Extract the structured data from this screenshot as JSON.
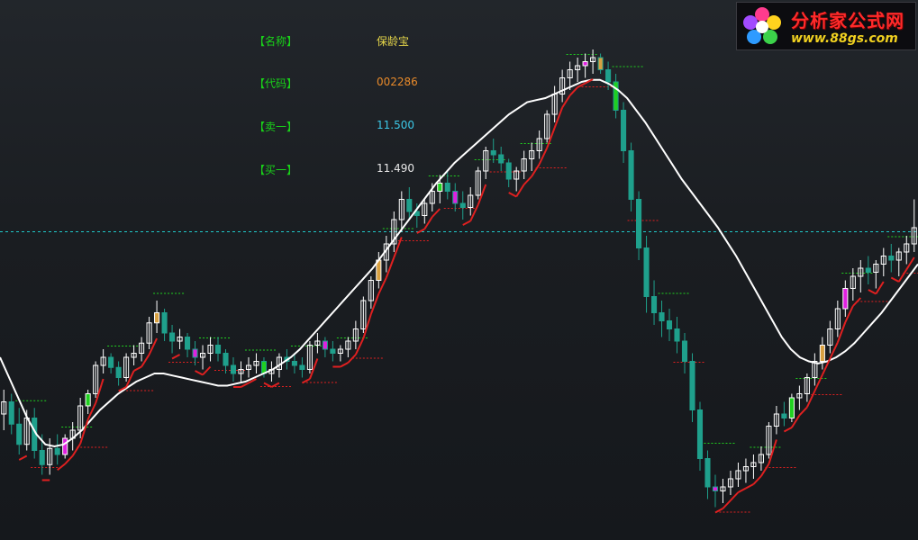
{
  "window": {
    "background": "#1c1f23"
  },
  "info_panel": [
    {
      "label": "【名称】",
      "value": "保龄宝",
      "color": "#e8d84a"
    },
    {
      "label": "【代码】",
      "value": "002286",
      "color": "#e88a2a"
    },
    {
      "label": "【卖一】",
      "value": "11.500",
      "color": "#3cc8e8"
    },
    {
      "label": "【买一】",
      "value": "11.490",
      "color": "#e8e8e8"
    }
  ],
  "logo": {
    "title": "分析家公式网",
    "url": "www.88gs.com"
  },
  "colors": {
    "up": "#ffffff",
    "down": "#1fa08c",
    "ma": "#ffffff",
    "red_line": "#e02020",
    "green_dash": "#1fd01f",
    "red_dash": "#e02020",
    "price_line": "#1fc8c8",
    "accent_magenta": "#e020e0",
    "accent_green": "#20d020",
    "accent_orange": "#d8a040"
  },
  "chart_data": {
    "type": "candlestick",
    "reference_price": 11.5,
    "candles": [
      [
        10.6,
        10.72,
        10.52,
        10.66
      ],
      [
        10.66,
        10.7,
        10.5,
        10.55
      ],
      [
        10.55,
        10.63,
        10.4,
        10.45
      ],
      [
        10.45,
        10.62,
        10.42,
        10.58
      ],
      [
        10.58,
        10.63,
        10.38,
        10.42
      ],
      [
        10.42,
        10.5,
        10.3,
        10.35
      ],
      [
        10.35,
        10.48,
        10.3,
        10.43
      ],
      [
        10.43,
        10.5,
        10.35,
        10.4
      ],
      [
        10.4,
        10.5,
        10.38,
        10.48
      ],
      [
        10.48,
        10.56,
        10.42,
        10.52
      ],
      [
        10.52,
        10.68,
        10.48,
        10.64
      ],
      [
        10.64,
        10.72,
        10.6,
        10.7
      ],
      [
        10.7,
        10.86,
        10.68,
        10.84
      ],
      [
        10.84,
        10.92,
        10.8,
        10.88
      ],
      [
        10.88,
        10.9,
        10.8,
        10.83
      ],
      [
        10.83,
        10.86,
        10.74,
        10.78
      ],
      [
        10.78,
        10.9,
        10.76,
        10.88
      ],
      [
        10.88,
        10.94,
        10.84,
        10.9
      ],
      [
        10.9,
        10.98,
        10.86,
        10.95
      ],
      [
        10.95,
        11.08,
        10.92,
        11.05
      ],
      [
        11.05,
        11.16,
        11.0,
        11.1
      ],
      [
        11.1,
        11.12,
        10.96,
        11.0
      ],
      [
        11.0,
        11.04,
        10.9,
        10.96
      ],
      [
        10.96,
        11.02,
        10.92,
        10.98
      ],
      [
        10.98,
        11.0,
        10.88,
        10.92
      ],
      [
        10.92,
        10.96,
        10.84,
        10.88
      ],
      [
        10.88,
        10.94,
        10.82,
        10.9
      ],
      [
        10.9,
        10.98,
        10.86,
        10.94
      ],
      [
        10.94,
        10.98,
        10.86,
        10.9
      ],
      [
        10.9,
        10.92,
        10.8,
        10.84
      ],
      [
        10.84,
        10.88,
        10.76,
        10.8
      ],
      [
        10.8,
        10.86,
        10.76,
        10.82
      ],
      [
        10.82,
        10.88,
        10.78,
        10.84
      ],
      [
        10.84,
        10.9,
        10.8,
        10.86
      ],
      [
        10.86,
        10.88,
        10.78,
        10.8
      ],
      [
        10.8,
        10.86,
        10.76,
        10.82
      ],
      [
        10.82,
        10.9,
        10.78,
        10.88
      ],
      [
        10.88,
        10.92,
        10.82,
        10.86
      ],
      [
        10.86,
        10.9,
        10.8,
        10.84
      ],
      [
        10.84,
        10.88,
        10.78,
        10.82
      ],
      [
        10.82,
        10.96,
        10.8,
        10.94
      ],
      [
        10.94,
        11.0,
        10.9,
        10.96
      ],
      [
        10.96,
        10.98,
        10.88,
        10.92
      ],
      [
        10.92,
        10.96,
        10.86,
        10.9
      ],
      [
        10.9,
        10.94,
        10.86,
        10.92
      ],
      [
        10.92,
        10.98,
        10.88,
        10.96
      ],
      [
        10.96,
        11.06,
        10.92,
        11.02
      ],
      [
        11.02,
        11.18,
        11.0,
        11.16
      ],
      [
        11.16,
        11.28,
        11.12,
        11.26
      ],
      [
        11.26,
        11.4,
        11.22,
        11.36
      ],
      [
        11.36,
        11.48,
        11.3,
        11.44
      ],
      [
        11.44,
        11.6,
        11.4,
        11.56
      ],
      [
        11.56,
        11.7,
        11.5,
        11.66
      ],
      [
        11.66,
        11.72,
        11.56,
        11.6
      ],
      [
        11.6,
        11.64,
        11.52,
        11.58
      ],
      [
        11.58,
        11.66,
        11.54,
        11.64
      ],
      [
        11.64,
        11.74,
        11.6,
        11.7
      ],
      [
        11.7,
        11.78,
        11.64,
        11.74
      ],
      [
        11.74,
        11.8,
        11.66,
        11.7
      ],
      [
        11.7,
        11.74,
        11.6,
        11.64
      ],
      [
        11.64,
        11.7,
        11.56,
        11.62
      ],
      [
        11.62,
        11.72,
        11.58,
        11.68
      ],
      [
        11.68,
        11.82,
        11.66,
        11.8
      ],
      [
        11.8,
        11.92,
        11.76,
        11.9
      ],
      [
        11.9,
        11.96,
        11.84,
        11.88
      ],
      [
        11.88,
        11.92,
        11.8,
        11.84
      ],
      [
        11.84,
        11.86,
        11.72,
        11.76
      ],
      [
        11.76,
        11.82,
        11.7,
        11.8
      ],
      [
        11.8,
        11.9,
        11.76,
        11.86
      ],
      [
        11.86,
        11.94,
        11.8,
        11.9
      ],
      [
        11.9,
        12.0,
        11.86,
        11.96
      ],
      [
        11.96,
        12.1,
        11.94,
        12.08
      ],
      [
        12.08,
        12.22,
        12.04,
        12.18
      ],
      [
        12.18,
        12.3,
        12.14,
        12.26
      ],
      [
        12.26,
        12.34,
        12.2,
        12.3
      ],
      [
        12.3,
        12.36,
        12.24,
        12.32
      ],
      [
        12.32,
        12.38,
        12.26,
        12.34
      ],
      [
        12.34,
        12.4,
        12.28,
        12.36
      ],
      [
        12.36,
        12.38,
        12.28,
        12.3
      ],
      [
        12.3,
        12.34,
        12.2,
        12.24
      ],
      [
        12.24,
        12.28,
        12.06,
        12.1
      ],
      [
        12.1,
        12.14,
        11.84,
        11.9
      ],
      [
        11.9,
        11.94,
        11.6,
        11.66
      ],
      [
        11.66,
        11.7,
        11.36,
        11.42
      ],
      [
        11.42,
        11.48,
        11.1,
        11.18
      ],
      [
        11.18,
        11.26,
        11.04,
        11.1
      ],
      [
        11.1,
        11.16,
        10.98,
        11.06
      ],
      [
        11.06,
        11.12,
        10.96,
        11.02
      ],
      [
        11.02,
        11.08,
        10.9,
        10.96
      ],
      [
        10.96,
        11.0,
        10.8,
        10.86
      ],
      [
        10.86,
        10.9,
        10.56,
        10.62
      ],
      [
        10.62,
        10.66,
        10.32,
        10.38
      ],
      [
        10.38,
        10.42,
        10.18,
        10.24
      ],
      [
        10.24,
        10.3,
        10.14,
        10.22
      ],
      [
        10.22,
        10.28,
        10.16,
        10.24
      ],
      [
        10.24,
        10.32,
        10.2,
        10.28
      ],
      [
        10.28,
        10.36,
        10.24,
        10.32
      ],
      [
        10.32,
        10.38,
        10.26,
        10.34
      ],
      [
        10.34,
        10.4,
        10.28,
        10.36
      ],
      [
        10.36,
        10.44,
        10.32,
        10.4
      ],
      [
        10.4,
        10.56,
        10.38,
        10.54
      ],
      [
        10.54,
        10.64,
        10.5,
        10.6
      ],
      [
        10.6,
        10.66,
        10.54,
        10.58
      ],
      [
        10.58,
        10.7,
        10.56,
        10.68
      ],
      [
        10.68,
        10.74,
        10.62,
        10.7
      ],
      [
        10.7,
        10.8,
        10.66,
        10.78
      ],
      [
        10.78,
        10.9,
        10.74,
        10.86
      ],
      [
        10.86,
        10.98,
        10.82,
        10.94
      ],
      [
        10.94,
        11.06,
        10.9,
        11.02
      ],
      [
        11.02,
        11.16,
        10.98,
        11.12
      ],
      [
        11.12,
        11.26,
        11.08,
        11.22
      ],
      [
        11.22,
        11.32,
        11.16,
        11.28
      ],
      [
        11.28,
        11.36,
        11.2,
        11.32
      ],
      [
        11.32,
        11.38,
        11.24,
        11.3
      ],
      [
        11.3,
        11.36,
        11.22,
        11.34
      ],
      [
        11.34,
        11.42,
        11.28,
        11.38
      ],
      [
        11.38,
        11.44,
        11.3,
        11.36
      ],
      [
        11.36,
        11.42,
        11.28,
        11.4
      ],
      [
        11.4,
        11.48,
        11.34,
        11.44
      ],
      [
        11.44,
        11.66,
        11.4,
        11.52
      ]
    ],
    "ma": [
      10.88,
      10.78,
      10.68,
      10.58,
      10.5,
      10.45,
      10.44,
      10.45,
      10.48,
      10.52,
      10.57,
      10.62,
      10.66,
      10.7,
      10.73,
      10.76,
      10.78,
      10.8,
      10.8,
      10.79,
      10.78,
      10.77,
      10.76,
      10.75,
      10.74,
      10.74,
      10.75,
      10.76,
      10.78,
      10.8,
      10.82,
      10.85,
      10.88,
      10.92,
      10.97,
      11.02,
      11.07,
      11.12,
      11.17,
      11.22,
      11.27,
      11.32,
      11.38,
      11.44,
      11.5,
      11.56,
      11.62,
      11.68,
      11.74,
      11.79,
      11.84,
      11.88,
      11.92,
      11.96,
      12.0,
      12.04,
      12.08,
      12.11,
      12.14,
      12.15,
      12.16,
      12.18,
      12.2,
      12.22,
      12.24,
      12.25,
      12.25,
      12.23,
      12.2,
      12.16,
      12.1,
      12.04,
      11.97,
      11.9,
      11.83,
      11.76,
      11.7,
      11.64,
      11.58,
      11.52,
      11.45,
      11.38,
      11.3,
      11.22,
      11.14,
      11.06,
      10.98,
      10.92,
      10.88,
      10.86,
      10.85,
      10.86,
      10.88,
      10.91,
      10.95,
      11.0,
      11.05,
      11.1,
      11.16,
      11.22,
      11.28,
      11.34
    ],
    "ylim": [
      10.0,
      12.6
    ]
  }
}
